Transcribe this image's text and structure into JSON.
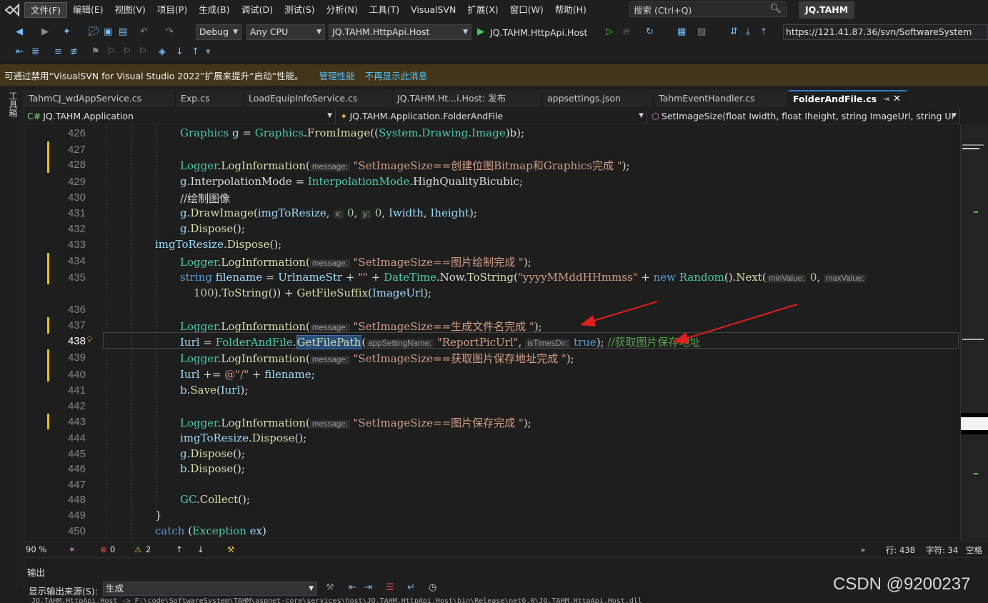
{
  "menu": {
    "items": [
      "文件(F)",
      "编辑(E)",
      "视图(V)",
      "项目(P)",
      "生成(B)",
      "调试(D)",
      "测试(S)",
      "分析(N)",
      "工具(T)",
      "VisualSVN",
      "扩展(X)",
      "窗口(W)",
      "帮助(H)"
    ],
    "search_label": "搜索 (Ctrl+Q)",
    "solution_name": "JQ.TAHM"
  },
  "toolbar": {
    "configuration": "Debug",
    "platform": "Any CPU",
    "startup_project": "JQ.TAHM.HttpApi.Host",
    "run_target": "JQ.TAHM.HttpApi.Host",
    "svn_url": "https://121.41.87.36/svn/SoftwareSystem"
  },
  "infobar": {
    "message": "可通过禁用“VisualSVN for Visual Studio 2022”扩展来提升“启动”性能。",
    "link_manage": "管理性能",
    "link_dismiss": "不再显示此消息"
  },
  "toolbox_label": "工具箱",
  "tabs": [
    {
      "label": "TahmCJ_wdAppService.cs"
    },
    {
      "label": "Exp.cs"
    },
    {
      "label": "LoadEquipInfoService.cs"
    },
    {
      "label": "JQ.TAHM.Ht...i.Host: 发布"
    },
    {
      "label": "appsettings.json"
    },
    {
      "label": "TahmEventHandler.cs"
    },
    {
      "label": "FolderAndFile.cs"
    }
  ],
  "navbar": {
    "project": "JQ.TAHM.Application",
    "class": "JQ.TAHM.Application.FolderAndFile",
    "member": "SetImageSize(float Iwidth, float Iheight, string ImageUrl, string Ur"
  },
  "line_numbers": [
    "426",
    "427",
    "428",
    "429",
    "430",
    "431",
    "432",
    "433",
    "434",
    "435",
    "",
    "436",
    "437",
    "438",
    "439",
    "440",
    "441",
    "442",
    "443",
    "444",
    "445",
    "446",
    "447",
    "448",
    "449",
    "450"
  ],
  "current_line": "438",
  "status": {
    "zoom": "90 %",
    "errors": "0",
    "warnings": "2",
    "line": "行: 438",
    "column": "字符: 34",
    "whitespace": "空格"
  },
  "output": {
    "title": "输出",
    "source_label": "显示输出来源(S):",
    "source_value": "生成",
    "partial_line": "JQ.TAHM.HttpApi.Host -> F:\\code\\SoftwareSystem\\TAHM\\aspnet-core\\services\\host\\JQ.TAHM.HttpApi.Host\\bin\\Release\\net6.0\\JQ.TAHM.HttpApi.Host.dll"
  },
  "watermark": "CSDN @9200237",
  "colors": {
    "accent_blue": "#2f7fd1",
    "change_marker": "#e4c21a",
    "annotation_arrow": "#e0201e",
    "infobar_bg": "#433519"
  }
}
